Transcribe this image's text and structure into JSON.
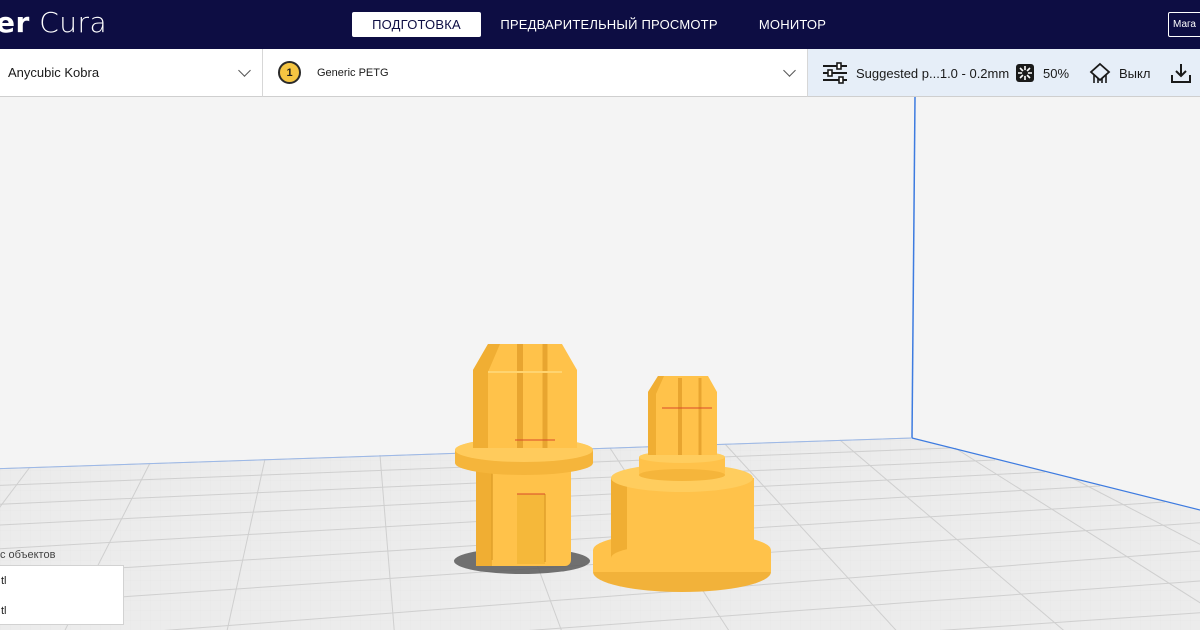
{
  "header": {
    "app_title_bold": "er",
    "app_title_rest": " Cura",
    "stages": [
      {
        "label": "ПОДГОТОВКА",
        "active": true
      },
      {
        "label": "ПРЕДВАРИТЕЛЬНЫЙ ПРОСМОТР",
        "active": false
      },
      {
        "label": "МОНИТОР",
        "active": false
      }
    ],
    "marketplace_label": "Мага"
  },
  "toolbar": {
    "printer_name": "Anycubic Kobra",
    "extruder_number": "1",
    "material_name": "Generic PETG",
    "profile_label": "Suggested p...1.0 - 0.2mm",
    "infill_label": "50%",
    "support_label": "Выкл",
    "icons": [
      "sliders-icon",
      "infill-icon",
      "support-icon",
      "save-icon",
      "chevron-down-icon",
      "extruder-badge-icon"
    ]
  },
  "object_list": {
    "title": "с объектов",
    "items": [
      "tl",
      "tl"
    ]
  },
  "colors": {
    "header_bg": "#0d0d43",
    "model_yellow": "#ffc24a",
    "settings_bg": "#e6eef8",
    "build_volume_blue": "#3d7be0"
  }
}
